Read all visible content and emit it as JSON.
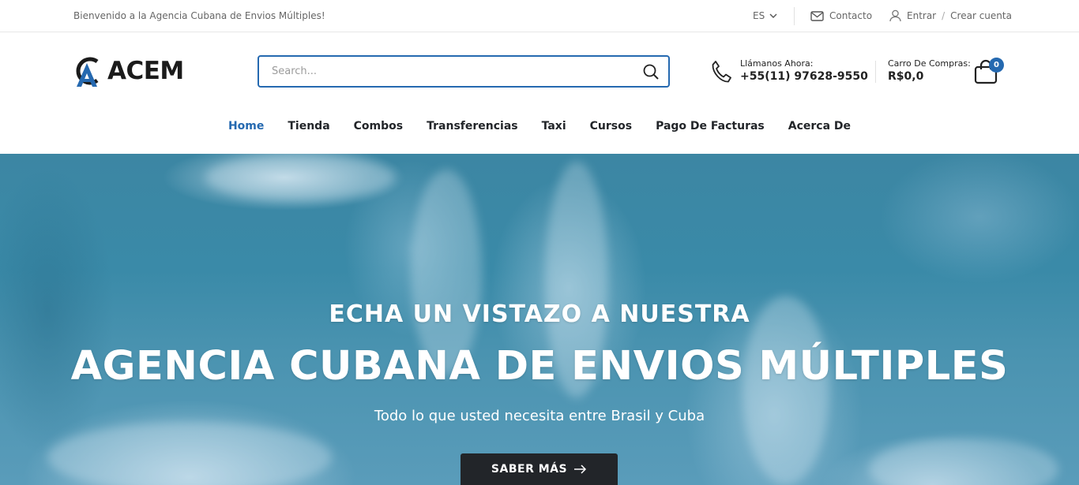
{
  "topbar": {
    "welcome": "Bienvenido a la Agencia Cubana de Envios Múltiples!",
    "language": "ES",
    "contact": "Contacto",
    "login": "Entrar",
    "separator": "/",
    "register": "Crear cuenta"
  },
  "header": {
    "logo_text": "ACEM",
    "search_placeholder": "Search...",
    "phone_label": "Llámanos Ahora:",
    "phone_number": "+55(11) 97628-9550",
    "cart_label": "Carro De Compras:",
    "cart_total": "R$0,0",
    "cart_count": "0"
  },
  "nav": {
    "items": [
      {
        "label": "Home",
        "active": true
      },
      {
        "label": "Tienda"
      },
      {
        "label": "Combos"
      },
      {
        "label": "Transferencias"
      },
      {
        "label": "Taxi"
      },
      {
        "label": "Cursos"
      },
      {
        "label": "Pago De Facturas"
      },
      {
        "label": "Acerca De"
      }
    ]
  },
  "hero": {
    "kicker": "ECHA UN VISTAZO A NUESTRA",
    "headline": "AGENCIA CUBANA DE ENVIOS MÚLTIPLES",
    "subtitle": "Todo lo que usted necesita entre Brasil y Cuba",
    "cta_label": "SABER MÁS"
  },
  "colors": {
    "accent": "#2569b0",
    "dark": "#222529",
    "hero_water": "#3c86a3"
  },
  "icons": [
    "chevron-down-icon",
    "mail-icon",
    "user-icon",
    "search-icon",
    "phone-icon",
    "shopping-bag-icon",
    "arrow-right-icon"
  ]
}
